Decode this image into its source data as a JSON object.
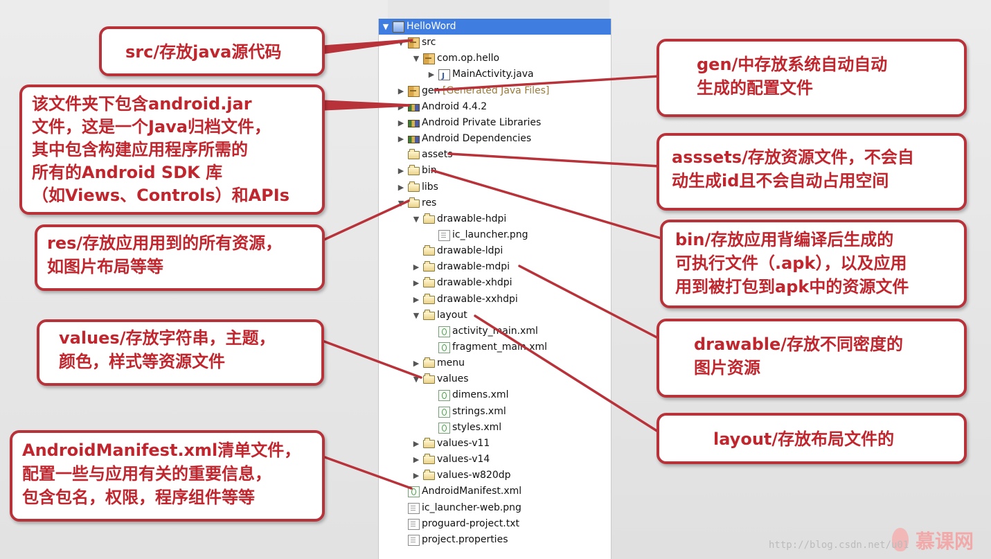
{
  "tree": {
    "items": [
      {
        "label": "HelloWord",
        "indent": 0,
        "icon": "project",
        "expand": "open",
        "header": true
      },
      {
        "label": "src",
        "indent": 1,
        "icon": "pkg",
        "expand": "open"
      },
      {
        "label": "com.op.hello",
        "indent": 2,
        "icon": "pkg",
        "expand": "open"
      },
      {
        "label": "MainActivity.java",
        "indent": 3,
        "icon": "java",
        "expand": "closed"
      },
      {
        "label": "gen",
        "indent": 1,
        "icon": "pkg",
        "expand": "closed",
        "extra": "[Generated Java Files]"
      },
      {
        "label": "Android 4.4.2",
        "indent": 1,
        "icon": "lib",
        "expand": "closed"
      },
      {
        "label": "Android Private Libraries",
        "indent": 1,
        "icon": "lib",
        "expand": "closed"
      },
      {
        "label": "Android Dependencies",
        "indent": 1,
        "icon": "lib",
        "expand": "closed"
      },
      {
        "label": "assets",
        "indent": 1,
        "icon": "folder",
        "expand": "none"
      },
      {
        "label": "bin",
        "indent": 1,
        "icon": "folder",
        "expand": "closed"
      },
      {
        "label": "libs",
        "indent": 1,
        "icon": "folder",
        "expand": "closed"
      },
      {
        "label": "res",
        "indent": 1,
        "icon": "folder",
        "expand": "open"
      },
      {
        "label": "drawable-hdpi",
        "indent": 2,
        "icon": "folder",
        "expand": "open"
      },
      {
        "label": "ic_launcher.png",
        "indent": 3,
        "icon": "file",
        "expand": "none"
      },
      {
        "label": "drawable-ldpi",
        "indent": 2,
        "icon": "folder",
        "expand": "none"
      },
      {
        "label": "drawable-mdpi",
        "indent": 2,
        "icon": "folder",
        "expand": "closed"
      },
      {
        "label": "drawable-xhdpi",
        "indent": 2,
        "icon": "folder",
        "expand": "closed"
      },
      {
        "label": "drawable-xxhdpi",
        "indent": 2,
        "icon": "folder",
        "expand": "closed"
      },
      {
        "label": "layout",
        "indent": 2,
        "icon": "folder",
        "expand": "open"
      },
      {
        "label": "activity_main.xml",
        "indent": 3,
        "icon": "xml",
        "expand": "none"
      },
      {
        "label": "fragment_main.xml",
        "indent": 3,
        "icon": "xml",
        "expand": "none"
      },
      {
        "label": "menu",
        "indent": 2,
        "icon": "folder",
        "expand": "closed"
      },
      {
        "label": "values",
        "indent": 2,
        "icon": "folder",
        "expand": "open"
      },
      {
        "label": "dimens.xml",
        "indent": 3,
        "icon": "xml",
        "expand": "none"
      },
      {
        "label": "strings.xml",
        "indent": 3,
        "icon": "xml",
        "expand": "none"
      },
      {
        "label": "styles.xml",
        "indent": 3,
        "icon": "xml",
        "expand": "none"
      },
      {
        "label": "values-v11",
        "indent": 2,
        "icon": "folder",
        "expand": "closed"
      },
      {
        "label": "values-v14",
        "indent": 2,
        "icon": "folder",
        "expand": "closed"
      },
      {
        "label": "values-w820dp",
        "indent": 2,
        "icon": "folder",
        "expand": "closed"
      },
      {
        "label": "AndroidManifest.xml",
        "indent": 1,
        "icon": "xml",
        "expand": "none"
      },
      {
        "label": "ic_launcher-web.png",
        "indent": 1,
        "icon": "file",
        "expand": "none"
      },
      {
        "label": "proguard-project.txt",
        "indent": 1,
        "icon": "file",
        "expand": "none"
      },
      {
        "label": "project.properties",
        "indent": 1,
        "icon": "file",
        "expand": "none"
      }
    ]
  },
  "callouts": {
    "src": "src/存放java源代码",
    "android_jar": "该文件夹下包含android.jar\n文件，这是一个Java归档文件，\n其中包含构建应用程序所需的\n所有的Android SDK 库\n（如Views、Controls）和APIs",
    "res": "res/存放应用用到的所有资源，\n如图片布局等等",
    "values": "values/存放字符串，主题，\n颜色，样式等资源文件",
    "manifest": "AndroidManifest.xml清单文件，\n配置一些与应用有关的重要信息，\n包含包名，权限，程序组件等等",
    "gen": "gen/中存放系统自动自动\n生成的配置文件",
    "assets": "asssets/存放资源文件，不会自\n动生成id且不会自动占用空间",
    "bin": "bin/存放应用背编译后生成的\n可执行文件（.apk），以及应用\n用到被打包到apk中的资源文件",
    "drawable": "drawable/存放不同密度的\n图片资源",
    "layout": "layout/存放布局文件的"
  },
  "watermark": "http://blog.csdn.net/u01",
  "brand": "慕课网",
  "colors": {
    "callout_border": "#b8323a",
    "callout_text": "#c0262e",
    "tree_header": "#3f7ee0",
    "connector": "#b8323a"
  }
}
